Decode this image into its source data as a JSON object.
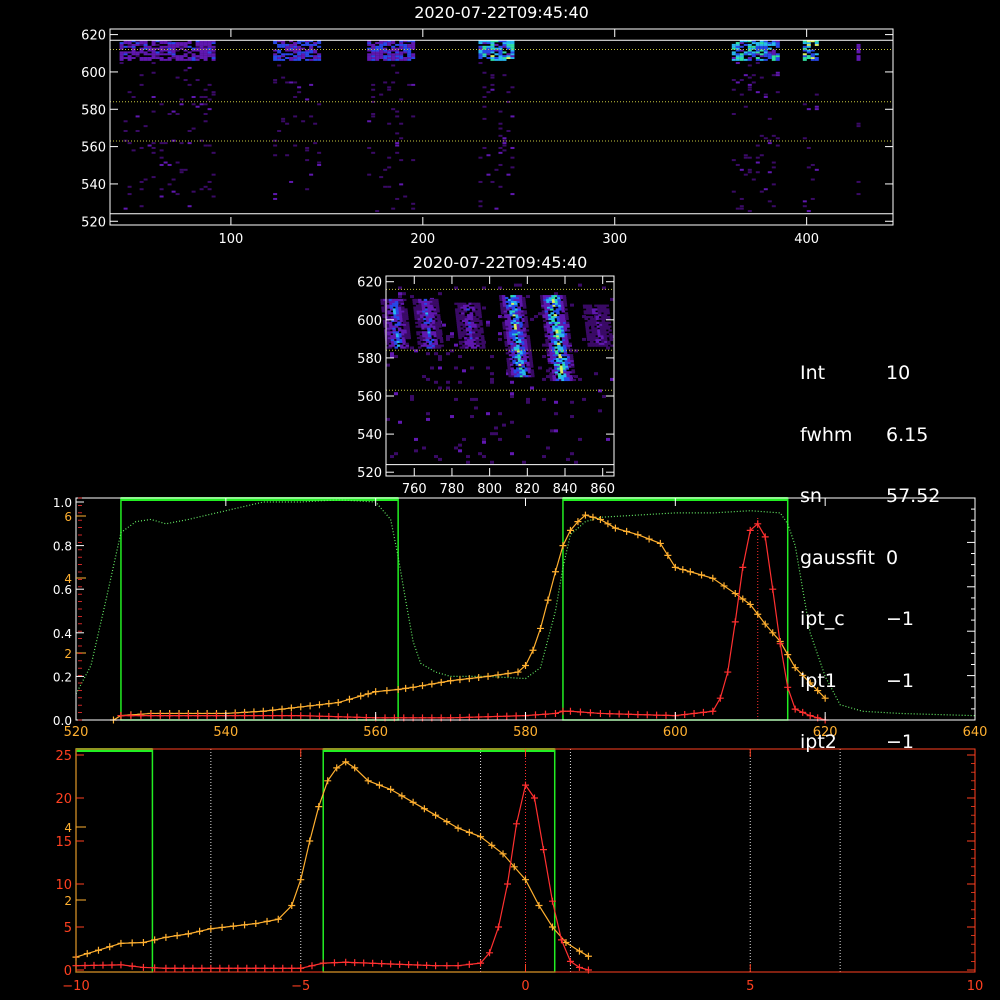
{
  "chart_data": [
    {
      "type": "heatmap",
      "title": "2020-07-22T09:45:40",
      "x_range": [
        37,
        445
      ],
      "y_range": [
        518,
        623
      ],
      "x_ticks": [
        100,
        200,
        300,
        400
      ],
      "y_ticks": [
        520,
        540,
        560,
        580,
        600,
        620
      ],
      "hlines": [
        612,
        584,
        563
      ],
      "white_hlines": [
        617,
        524
      ],
      "bands": [
        {
          "x": [
            42,
            90
          ],
          "intensity": 0.45
        },
        {
          "x": [
            122,
            147
          ],
          "intensity": 0.55
        },
        {
          "x": [
            171,
            196
          ],
          "intensity": 0.5
        },
        {
          "x": [
            229,
            246
          ],
          "intensity": 0.85
        },
        {
          "x": [
            361,
            386
          ],
          "intensity": 0.8
        },
        {
          "x": [
            398,
            405
          ],
          "intensity": 0.9
        },
        {
          "x": [
            426,
            428
          ],
          "intensity": 0.4
        }
      ]
    },
    {
      "type": "heatmap",
      "title": "2020-07-22T09:45:40",
      "x_range": [
        745,
        866
      ],
      "y_range": [
        518,
        623
      ],
      "x_ticks": [
        760,
        780,
        800,
        820,
        840,
        860
      ],
      "y_ticks": [
        520,
        540,
        560,
        580,
        600,
        620
      ],
      "hlines": [
        616,
        584,
        563
      ],
      "white_hlines": [
        524
      ],
      "streaks": [
        {
          "x": 751,
          "y": [
            585,
            610
          ],
          "intensity": 0.65
        },
        {
          "x": 768,
          "y": [
            585,
            610
          ],
          "intensity": 0.55
        },
        {
          "x": 790,
          "y": [
            585,
            608
          ],
          "intensity": 0.45
        },
        {
          "x": 816,
          "y": [
            570,
            612
          ],
          "intensity": 0.85
        },
        {
          "x": 838,
          "y": [
            568,
            612
          ],
          "intensity": 0.95
        },
        {
          "x": 858,
          "y": [
            586,
            607
          ],
          "intensity": 0.35
        }
      ]
    },
    {
      "type": "line",
      "x_range": [
        520,
        640
      ],
      "x_ticks": [
        520,
        540,
        560,
        580,
        600,
        620,
        640
      ],
      "y_ticks_left_white": [
        "0.0",
        "0.2",
        "0.4",
        "0.6",
        "0.8",
        "1.0"
      ],
      "y_ticks_left_orange": [
        "2",
        "4",
        "6"
      ],
      "green_windows": [
        [
          526,
          563
        ],
        [
          585,
          615
        ]
      ],
      "red_peak_x": 611,
      "series": [
        {
          "color": "#66ee66",
          "style": "dotted",
          "x": [
            520,
            522,
            524,
            526,
            528,
            530,
            532,
            535,
            540,
            545,
            550,
            555,
            560,
            562,
            563,
            564,
            565,
            566,
            568,
            570,
            575,
            580,
            582,
            584,
            585,
            586,
            588,
            590,
            600,
            605,
            610,
            614,
            615,
            616,
            617,
            618,
            620,
            622,
            625,
            630,
            640
          ],
          "y": [
            0.12,
            0.25,
            0.55,
            0.86,
            0.91,
            0.92,
            0.9,
            0.92,
            0.96,
            1.0,
            1.0,
            1.01,
            1.0,
            0.92,
            0.75,
            0.55,
            0.36,
            0.26,
            0.22,
            0.2,
            0.2,
            0.19,
            0.24,
            0.5,
            0.7,
            0.85,
            0.91,
            0.93,
            0.95,
            0.95,
            0.96,
            0.95,
            0.9,
            0.8,
            0.6,
            0.4,
            0.2,
            0.07,
            0.04,
            0.03,
            0.02
          ]
        },
        {
          "color": "#ffb030",
          "style": "plus",
          "x": [
            525,
            526,
            530,
            535,
            540,
            545,
            550,
            555,
            558,
            560,
            563,
            565,
            570,
            575,
            579,
            580,
            581,
            582,
            583,
            584,
            585,
            586,
            587,
            588,
            590,
            592,
            595,
            598,
            600,
            602,
            605,
            608,
            610,
            612,
            614,
            616,
            618,
            620
          ],
          "y": [
            0.0,
            0.02,
            0.03,
            0.03,
            0.03,
            0.04,
            0.06,
            0.08,
            0.11,
            0.13,
            0.14,
            0.15,
            0.18,
            0.2,
            0.22,
            0.25,
            0.32,
            0.42,
            0.55,
            0.68,
            0.8,
            0.87,
            0.91,
            0.94,
            0.92,
            0.88,
            0.85,
            0.81,
            0.7,
            0.68,
            0.65,
            0.58,
            0.53,
            0.44,
            0.36,
            0.24,
            0.17,
            0.1
          ]
        },
        {
          "color": "#ff3030",
          "style": "plus",
          "x": [
            526,
            530,
            540,
            550,
            560,
            570,
            580,
            584,
            585,
            586,
            590,
            600,
            605,
            606,
            607,
            608,
            609,
            610,
            611,
            612,
            613,
            614,
            615,
            616,
            618,
            620
          ],
          "y": [
            0.02,
            0.02,
            0.02,
            0.02,
            0.01,
            0.01,
            0.02,
            0.03,
            0.04,
            0.04,
            0.03,
            0.02,
            0.04,
            0.1,
            0.22,
            0.45,
            0.7,
            0.87,
            0.9,
            0.84,
            0.6,
            0.35,
            0.15,
            0.05,
            0.02,
            0.0
          ]
        }
      ]
    },
    {
      "type": "line",
      "x_range": [
        -10,
        10
      ],
      "x_ticks": [
        -10,
        -5,
        0,
        5,
        10
      ],
      "y_ticks_right_red": [
        "0",
        "5",
        "10",
        "15",
        "20",
        "25"
      ],
      "y_ticks_left_orange": [
        "2",
        "4"
      ],
      "green_windows": [
        [
          -10,
          -8.3
        ],
        [
          -4.5,
          0.65
        ]
      ],
      "white_dotted_x": [
        -7.0,
        -5.0,
        -1.0,
        1.0,
        5.0,
        7.0
      ],
      "red_dotted_x": [
        0
      ],
      "series": [
        {
          "color": "#ffb030",
          "style": "plus",
          "x": [
            -10,
            -9.5,
            -9.0,
            -8.5,
            -8.0,
            -7.5,
            -7.0,
            -6.5,
            -6.0,
            -5.5,
            -5.2,
            -5.0,
            -4.8,
            -4.6,
            -4.4,
            -4.2,
            -4.0,
            -3.8,
            -3.5,
            -3.0,
            -2.5,
            -2.0,
            -1.5,
            -1.0,
            -0.5,
            0.0,
            0.3,
            0.6,
            0.9,
            1.2,
            1.4
          ],
          "y": [
            1.5,
            2.3,
            3.1,
            3.2,
            3.8,
            4.2,
            4.8,
            5.1,
            5.4,
            5.9,
            7.5,
            10.5,
            15.0,
            19.0,
            22.0,
            23.5,
            24.2,
            23.5,
            22.0,
            21.0,
            19.5,
            18.0,
            16.5,
            15.5,
            13.5,
            10.5,
            7.5,
            5.0,
            3.2,
            2.2,
            1.6
          ]
        },
        {
          "color": "#ff3030",
          "style": "plus",
          "x": [
            -10,
            -9,
            -8.5,
            -8,
            -7,
            -6,
            -5,
            -4.5,
            -4,
            -3,
            -2,
            -1.5,
            -1,
            -0.8,
            -0.6,
            -0.4,
            -0.2,
            0,
            0.2,
            0.4,
            0.6,
            0.8,
            1.0,
            1.2,
            1.4
          ],
          "y": [
            0.5,
            0.6,
            0.3,
            0.2,
            0.2,
            0.2,
            0.2,
            0.8,
            0.9,
            0.7,
            0.5,
            0.5,
            0.8,
            2.0,
            5.0,
            10.0,
            17.0,
            21.5,
            20.0,
            14.0,
            8.0,
            3.5,
            1.0,
            0.3,
            0.0
          ]
        }
      ]
    }
  ],
  "info_panel": [
    {
      "key": "Int",
      "value": "10"
    },
    {
      "key": "fwhm",
      "value": "6.15"
    },
    {
      "key": "sn",
      "value": "57.52"
    },
    {
      "key": "gaussfit",
      "value": "0"
    },
    {
      "key": "ipt_c",
      "value": "−1"
    },
    {
      "key": "ipt1",
      "value": "−1"
    },
    {
      "key": "ipt2",
      "value": "−1"
    }
  ],
  "colors": {
    "axes": "#ffffff",
    "lower_axes": "#ff4020",
    "green": "#22ee22",
    "orange": "#ffb030",
    "red": "#ff3030"
  }
}
